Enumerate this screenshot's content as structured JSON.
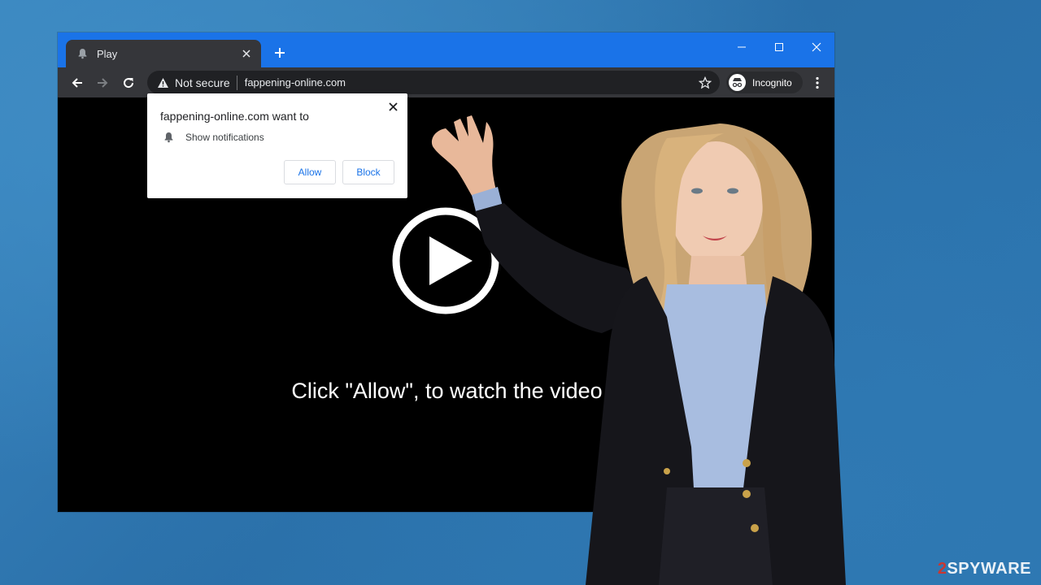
{
  "browser": {
    "tab": {
      "title": "Play",
      "icon": "bell-icon"
    },
    "new_tab_icon": "plus-icon",
    "window_controls": [
      "minimize-icon",
      "maximize-icon",
      "close-icon"
    ],
    "toolbar": {
      "back_icon": "arrow-left-icon",
      "forward_icon": "arrow-right-icon",
      "reload_icon": "reload-icon",
      "security_label": "Not secure",
      "url": "fappening-online.com",
      "bookmark_icon": "star-icon",
      "profile_label": "Incognito",
      "menu_icon": "kebab-menu-icon"
    },
    "colors": {
      "titlebar": "#1a73e8",
      "toolbar": "#35363a",
      "omnibox": "#202124",
      "page_background": "#000000"
    }
  },
  "permission_prompt": {
    "title": "fappening-online.com want to",
    "permission_label": "Show notifications",
    "allow_label": "Allow",
    "block_label": "Block"
  },
  "page": {
    "call_to_action": "Click \"Allow\", to watch the video",
    "play_icon": "play-icon"
  },
  "watermark": {
    "prefix": "2",
    "text": "SPYWARE"
  }
}
